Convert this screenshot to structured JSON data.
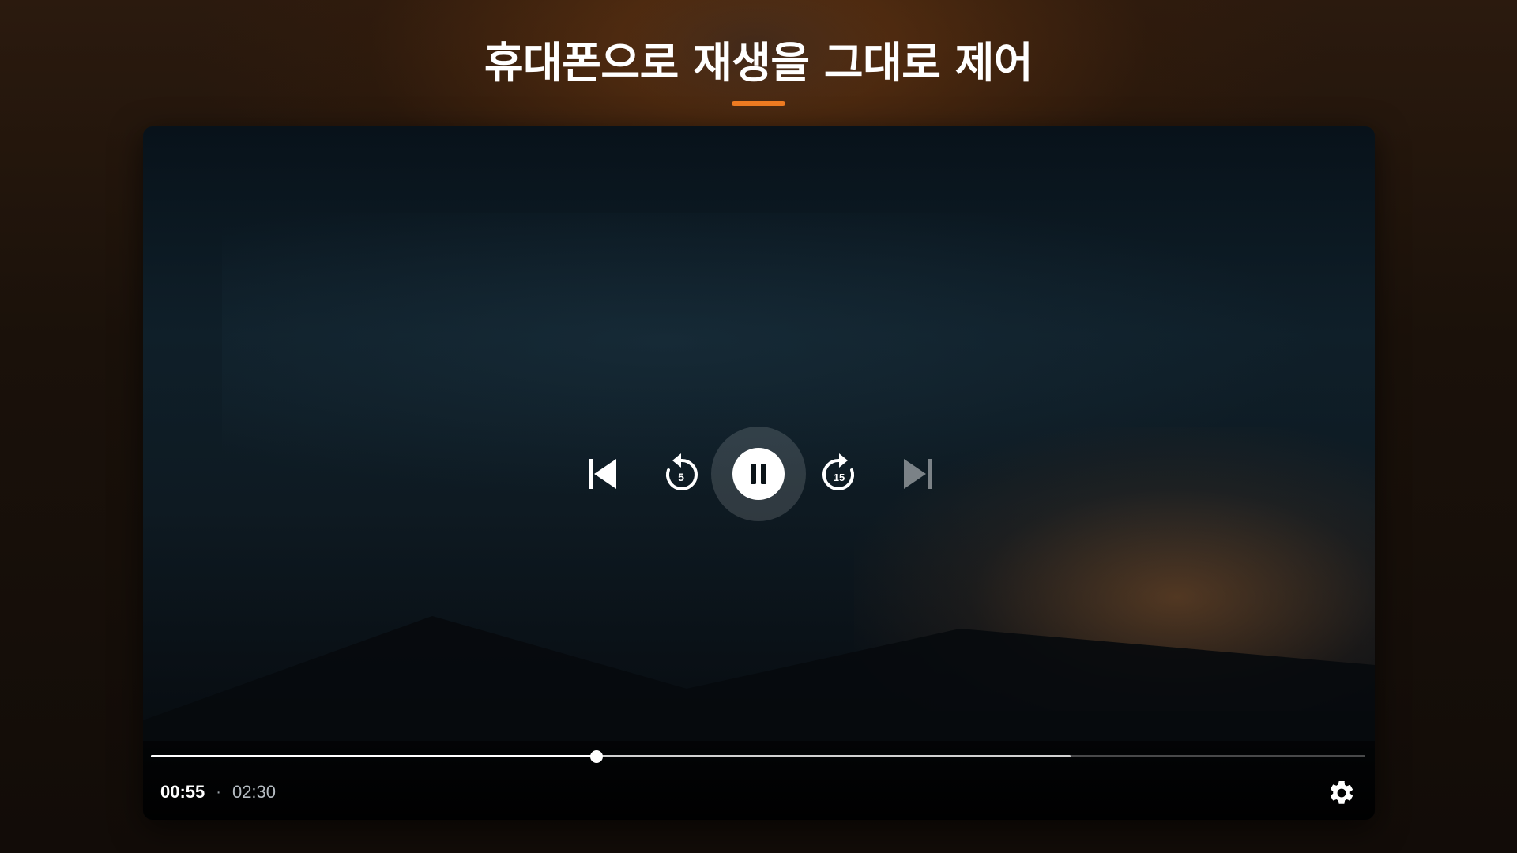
{
  "header": {
    "title": "휴대폰으로 재생을 그대로 제어"
  },
  "player": {
    "controls": {
      "previous_icon": "skip-previous-icon",
      "rewind_icon": "replay-5-icon",
      "rewind_label": "5",
      "play_pause_icon": "pause-icon",
      "forward_icon": "forward-15-icon",
      "forward_label": "15",
      "next_icon": "skip-next-icon",
      "next_enabled": false
    },
    "playback": {
      "current_time": "00:55",
      "separator": "·",
      "total_time": "02:30",
      "played_fraction": 0.3667,
      "buffered_fraction": 0.757
    },
    "settings_icon": "gear-icon"
  },
  "colors": {
    "accent": "#f07c22",
    "title": "#ffffff",
    "background": "#120c08"
  }
}
